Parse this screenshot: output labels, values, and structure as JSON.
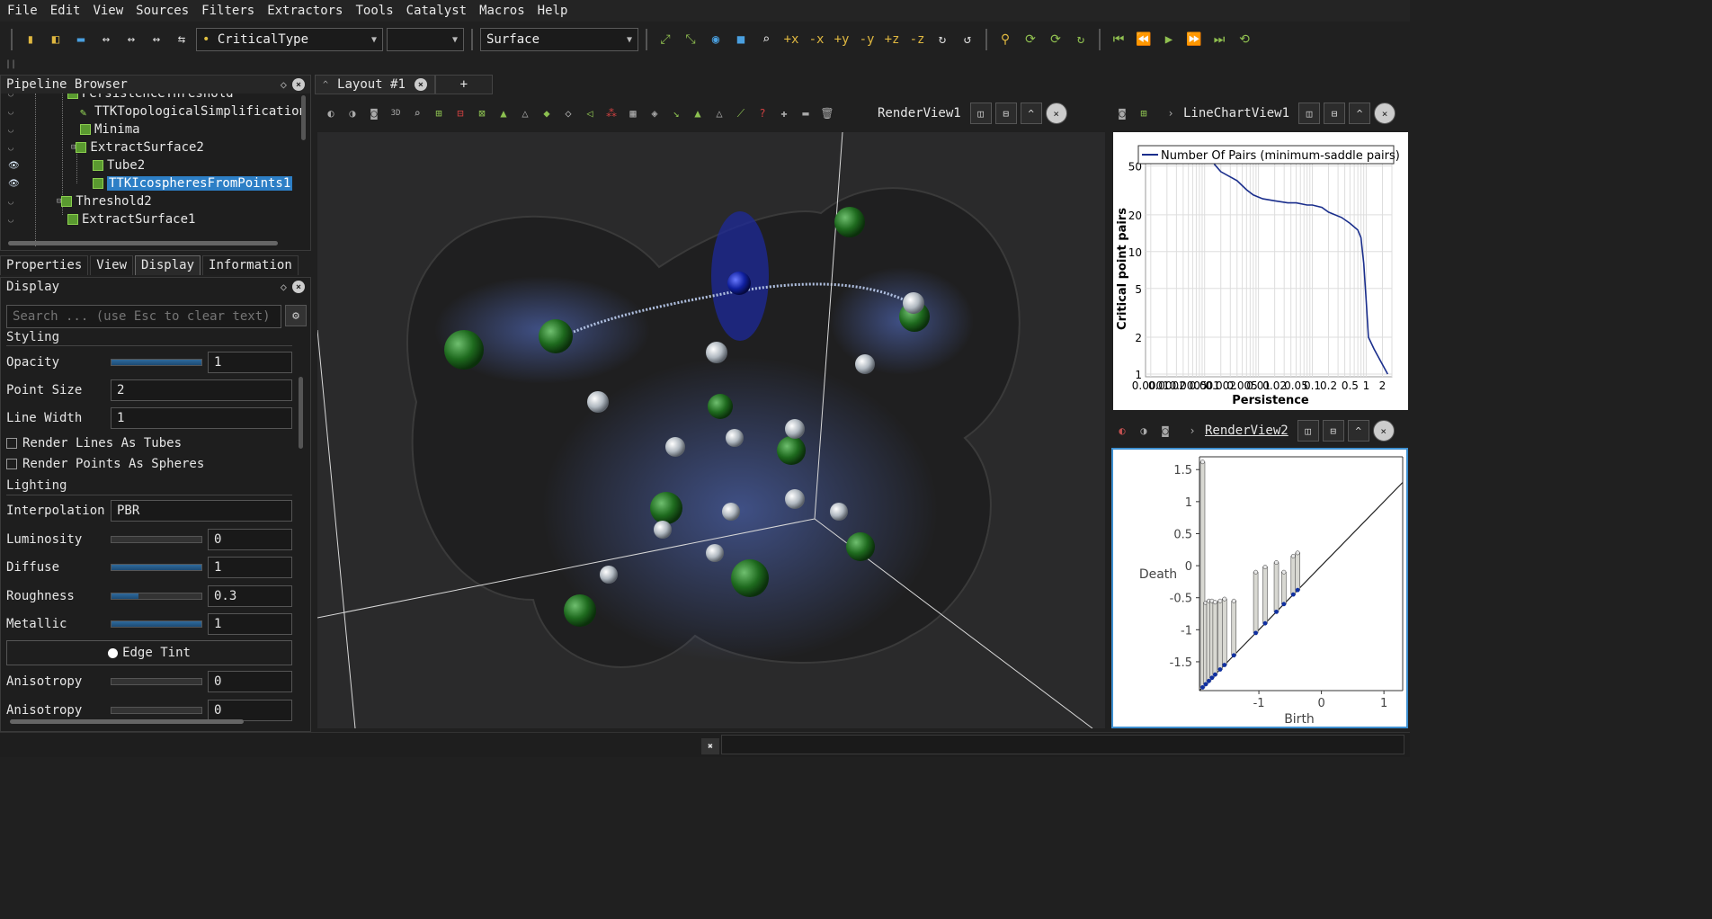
{
  "menu": [
    "File",
    "Edit",
    "View",
    "Sources",
    "Filters",
    "Extractors",
    "Tools",
    "Catalyst",
    "Macros",
    "Help"
  ],
  "toolbar": {
    "color_by": "CriticalType",
    "color_component": "",
    "representation": "Surface"
  },
  "pipeline": {
    "title": "Pipeline Browser",
    "items": [
      {
        "label": "PersistenceThreshold",
        "visible": false,
        "selected": false
      },
      {
        "label": "TTKTopologicalSimplification",
        "visible": false,
        "selected": false
      },
      {
        "label": "Minima",
        "visible": false,
        "selected": false
      },
      {
        "label": "ExtractSurface2",
        "visible": false,
        "selected": false
      },
      {
        "label": "Tube2",
        "visible": true,
        "selected": false
      },
      {
        "label": "TTKIcospheresFromPoints1",
        "visible": true,
        "selected": true
      },
      {
        "label": "Threshold2",
        "visible": false,
        "selected": false
      },
      {
        "label": "ExtractSurface1",
        "visible": false,
        "selected": false
      }
    ]
  },
  "tabs": [
    "Properties",
    "View",
    "Display",
    "Information"
  ],
  "active_tab": "Display",
  "display": {
    "title": "Display",
    "search_placeholder": "Search ... (use Esc to clear text)",
    "styling_label": "Styling",
    "opacity_label": "Opacity",
    "opacity": "1",
    "opacity_level": 1,
    "point_size_label": "Point Size",
    "point_size": "2",
    "line_width_label": "Line Width",
    "line_width": "1",
    "render_lines_tubes": "Render Lines As Tubes",
    "render_points_spheres": "Render Points As Spheres",
    "lighting_label": "Lighting",
    "interpolation_label": "Interpolation",
    "interpolation": "PBR",
    "luminosity_label": "Luminosity",
    "luminosity": "0",
    "luminosity_level": 0,
    "diffuse_label": "Diffuse",
    "diffuse": "1",
    "diffuse_level": 1,
    "roughness_label": "Roughness",
    "roughness": "0.3",
    "roughness_level": 0.3,
    "metallic_label": "Metallic",
    "metallic": "1",
    "metallic_level": 1,
    "edge_tint_label": "Edge Tint",
    "anisotropy_label": "Anisotropy",
    "anisotropy": "0",
    "anisotropy_level": 0,
    "anisotropy2_label": "Anisotropy",
    "anisotropy2": "0"
  },
  "layout": {
    "tab_label": "Layout #1",
    "add_label": "+"
  },
  "views": {
    "render1_title": "RenderView1",
    "linechart_title": "LineChartView1",
    "render2_title": "RenderView2"
  },
  "chart_data": [
    {
      "type": "line",
      "legend": [
        "Number Of Pairs (minimum-saddle pairs)"
      ],
      "xlabel": "Persistence",
      "ylabel": "Critical point pairs",
      "x_scale": "log",
      "y_scale": "log",
      "y_ticks": [
        "50",
        "20",
        "10",
        "5",
        "2",
        "1"
      ],
      "x_ticks": [
        "0.0001",
        "0.0002",
        "0.0005",
        "0.001",
        "0.002",
        "0.005",
        "0.01",
        "0.02",
        "0.05",
        "0.1",
        "0.2",
        "0.5",
        "1",
        "2"
      ],
      "series": [
        {
          "name": "Number Of Pairs (minimum-saddle pairs)",
          "color": "#1a2e8c",
          "x": [
            0.0015,
            0.002,
            0.004,
            0.006,
            0.008,
            0.012,
            0.02,
            0.035,
            0.05,
            0.08,
            0.1,
            0.15,
            0.2,
            0.35,
            0.5,
            0.7,
            0.8,
            0.9,
            1.0,
            1.1,
            1.4,
            2.5
          ],
          "y": [
            52,
            45,
            38,
            32,
            29,
            27,
            26,
            25,
            25,
            24,
            24,
            23,
            21,
            19,
            17,
            15,
            13,
            8,
            4,
            2,
            1.6,
            1
          ]
        }
      ]
    },
    {
      "type": "scatter",
      "xlabel": "Birth",
      "ylabel": "Death",
      "x_ticks": [
        "-1",
        "0",
        "1"
      ],
      "y_ticks": [
        "1.5",
        "1",
        "0.5",
        "0",
        "-0.5",
        "-1",
        "-1.5"
      ],
      "xlim": [
        -1.95,
        1.3
      ],
      "ylim": [
        -1.95,
        1.7
      ],
      "bars": [
        {
          "birth": -1.9,
          "death": 1.62
        },
        {
          "birth": -1.85,
          "death": -0.58
        },
        {
          "birth": -1.8,
          "death": -0.55
        },
        {
          "birth": -1.75,
          "death": -0.55
        },
        {
          "birth": -1.7,
          "death": -0.57
        },
        {
          "birth": -1.62,
          "death": -0.55
        },
        {
          "birth": -1.55,
          "death": -0.52
        },
        {
          "birth": -1.4,
          "death": -0.55
        },
        {
          "birth": -1.05,
          "death": -0.1
        },
        {
          "birth": -0.9,
          "death": -0.02
        },
        {
          "birth": -0.72,
          "death": 0.05
        },
        {
          "birth": -0.6,
          "death": -0.1
        },
        {
          "birth": -0.45,
          "death": 0.15
        },
        {
          "birth": -0.38,
          "death": 0.2
        }
      ]
    }
  ]
}
